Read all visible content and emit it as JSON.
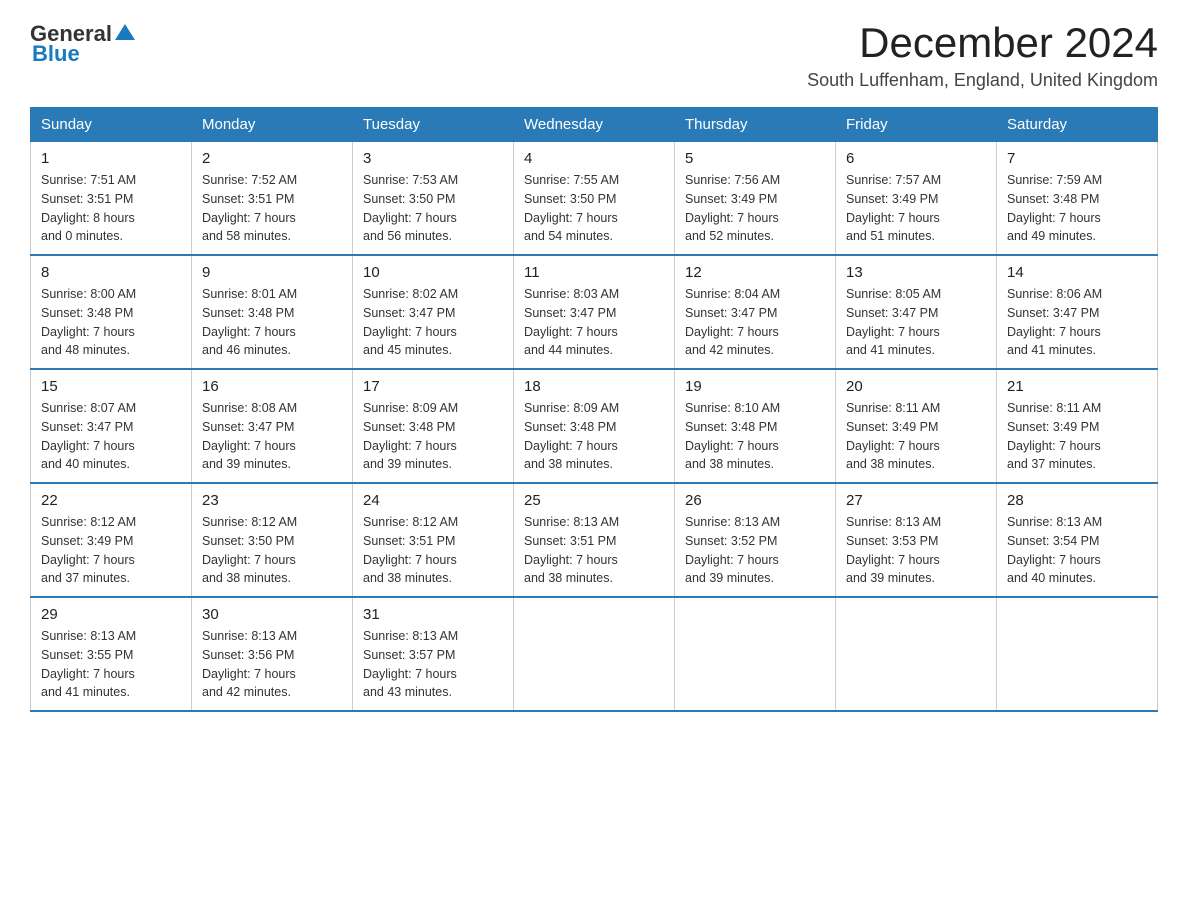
{
  "header": {
    "logo_general": "General",
    "logo_blue": "Blue",
    "month": "December 2024",
    "location": "South Luffenham, England, United Kingdom"
  },
  "days_of_week": [
    "Sunday",
    "Monday",
    "Tuesday",
    "Wednesday",
    "Thursday",
    "Friday",
    "Saturday"
  ],
  "weeks": [
    [
      {
        "day": "1",
        "sunrise": "7:51 AM",
        "sunset": "3:51 PM",
        "daylight": "8 hours and 0 minutes."
      },
      {
        "day": "2",
        "sunrise": "7:52 AM",
        "sunset": "3:51 PM",
        "daylight": "7 hours and 58 minutes."
      },
      {
        "day": "3",
        "sunrise": "7:53 AM",
        "sunset": "3:50 PM",
        "daylight": "7 hours and 56 minutes."
      },
      {
        "day": "4",
        "sunrise": "7:55 AM",
        "sunset": "3:50 PM",
        "daylight": "7 hours and 54 minutes."
      },
      {
        "day": "5",
        "sunrise": "7:56 AM",
        "sunset": "3:49 PM",
        "daylight": "7 hours and 52 minutes."
      },
      {
        "day": "6",
        "sunrise": "7:57 AM",
        "sunset": "3:49 PM",
        "daylight": "7 hours and 51 minutes."
      },
      {
        "day": "7",
        "sunrise": "7:59 AM",
        "sunset": "3:48 PM",
        "daylight": "7 hours and 49 minutes."
      }
    ],
    [
      {
        "day": "8",
        "sunrise": "8:00 AM",
        "sunset": "3:48 PM",
        "daylight": "7 hours and 48 minutes."
      },
      {
        "day": "9",
        "sunrise": "8:01 AM",
        "sunset": "3:48 PM",
        "daylight": "7 hours and 46 minutes."
      },
      {
        "day": "10",
        "sunrise": "8:02 AM",
        "sunset": "3:47 PM",
        "daylight": "7 hours and 45 minutes."
      },
      {
        "day": "11",
        "sunrise": "8:03 AM",
        "sunset": "3:47 PM",
        "daylight": "7 hours and 44 minutes."
      },
      {
        "day": "12",
        "sunrise": "8:04 AM",
        "sunset": "3:47 PM",
        "daylight": "7 hours and 42 minutes."
      },
      {
        "day": "13",
        "sunrise": "8:05 AM",
        "sunset": "3:47 PM",
        "daylight": "7 hours and 41 minutes."
      },
      {
        "day": "14",
        "sunrise": "8:06 AM",
        "sunset": "3:47 PM",
        "daylight": "7 hours and 41 minutes."
      }
    ],
    [
      {
        "day": "15",
        "sunrise": "8:07 AM",
        "sunset": "3:47 PM",
        "daylight": "7 hours and 40 minutes."
      },
      {
        "day": "16",
        "sunrise": "8:08 AM",
        "sunset": "3:47 PM",
        "daylight": "7 hours and 39 minutes."
      },
      {
        "day": "17",
        "sunrise": "8:09 AM",
        "sunset": "3:48 PM",
        "daylight": "7 hours and 39 minutes."
      },
      {
        "day": "18",
        "sunrise": "8:09 AM",
        "sunset": "3:48 PM",
        "daylight": "7 hours and 38 minutes."
      },
      {
        "day": "19",
        "sunrise": "8:10 AM",
        "sunset": "3:48 PM",
        "daylight": "7 hours and 38 minutes."
      },
      {
        "day": "20",
        "sunrise": "8:11 AM",
        "sunset": "3:49 PM",
        "daylight": "7 hours and 38 minutes."
      },
      {
        "day": "21",
        "sunrise": "8:11 AM",
        "sunset": "3:49 PM",
        "daylight": "7 hours and 37 minutes."
      }
    ],
    [
      {
        "day": "22",
        "sunrise": "8:12 AM",
        "sunset": "3:49 PM",
        "daylight": "7 hours and 37 minutes."
      },
      {
        "day": "23",
        "sunrise": "8:12 AM",
        "sunset": "3:50 PM",
        "daylight": "7 hours and 38 minutes."
      },
      {
        "day": "24",
        "sunrise": "8:12 AM",
        "sunset": "3:51 PM",
        "daylight": "7 hours and 38 minutes."
      },
      {
        "day": "25",
        "sunrise": "8:13 AM",
        "sunset": "3:51 PM",
        "daylight": "7 hours and 38 minutes."
      },
      {
        "day": "26",
        "sunrise": "8:13 AM",
        "sunset": "3:52 PM",
        "daylight": "7 hours and 39 minutes."
      },
      {
        "day": "27",
        "sunrise": "8:13 AM",
        "sunset": "3:53 PM",
        "daylight": "7 hours and 39 minutes."
      },
      {
        "day": "28",
        "sunrise": "8:13 AM",
        "sunset": "3:54 PM",
        "daylight": "7 hours and 40 minutes."
      }
    ],
    [
      {
        "day": "29",
        "sunrise": "8:13 AM",
        "sunset": "3:55 PM",
        "daylight": "7 hours and 41 minutes."
      },
      {
        "day": "30",
        "sunrise": "8:13 AM",
        "sunset": "3:56 PM",
        "daylight": "7 hours and 42 minutes."
      },
      {
        "day": "31",
        "sunrise": "8:13 AM",
        "sunset": "3:57 PM",
        "daylight": "7 hours and 43 minutes."
      },
      null,
      null,
      null,
      null
    ]
  ]
}
